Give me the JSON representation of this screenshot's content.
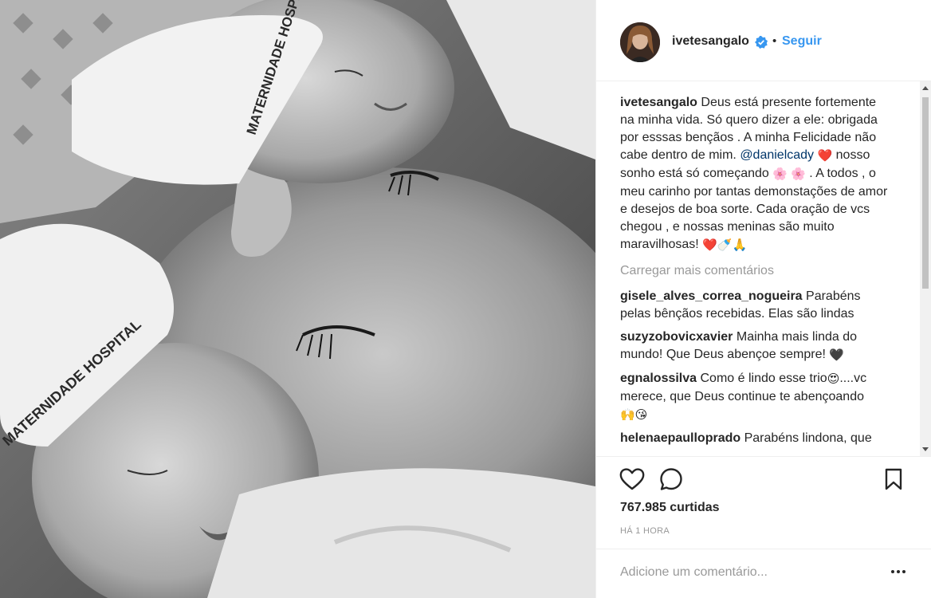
{
  "post": {
    "photo_label": "MATERNIDADE HOSPITAL",
    "username": "ivetesangalo",
    "follow_label": "Seguir",
    "separator": "•"
  },
  "caption": {
    "username": "ivetesangalo",
    "text_1": "Deus está presente fortemente na minha vida. Só quero dizer a ele: obrigada por esssas bençãos . A minha Felicidade não cabe dentro de mim.",
    "mention": "@danielcady",
    "emoji_1": "❤️",
    "text_2": " nosso sonho está só começando ",
    "emoji_2": "🌸 🌸",
    "text_3": " . A todos , o meu carinho por tantas demonstações de amor e desejos de boa sorte. Cada oração de vcs chegou , e nossas meninas são muito maravilhosas! ",
    "emoji_3": "❤️🍼🙏"
  },
  "load_more": "Carregar mais comentários",
  "comments": [
    {
      "username": "gisele_alves_correa_nogueira",
      "text": "Parabéns pelas bênçãos recebidas. Elas são lindas",
      "emoji": ""
    },
    {
      "username": "suzyzobovicxavier",
      "text": "Mainha mais linda do mundo! Que Deus abençoe sempre! ",
      "emoji": "🖤"
    },
    {
      "username": "egnalossilva",
      "text": "Como é lindo esse trio",
      "text_after_emoji": "....vc merece, que Deus continue te abençoando ",
      "emoji": "😍",
      "emoji_end": "🙌😘"
    },
    {
      "username": "helenaepaulloprado",
      "text": "Parabéns lindona, que",
      "emoji": ""
    }
  ],
  "likes": "767.985 curtidas",
  "timestamp": "HÁ 1 HORA",
  "add_comment_placeholder": "Adicione um comentário...",
  "icons": {
    "like": "heart-icon",
    "comment": "comment-bubble-icon",
    "save": "bookmark-icon",
    "more": "ellipsis-icon",
    "verified": "verified-badge-icon"
  },
  "colors": {
    "link": "#3897f0",
    "verified": "#3897f0",
    "mention": "#003569",
    "muted": "#999999"
  }
}
